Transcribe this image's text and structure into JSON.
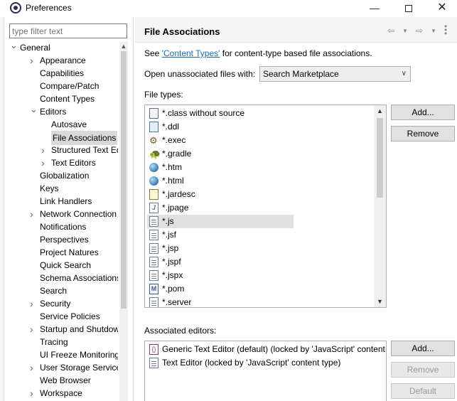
{
  "window": {
    "title": "Preferences",
    "minimize_glyph": "—",
    "close_glyph": "✕"
  },
  "filter": {
    "placeholder": "type filter text"
  },
  "tree": [
    {
      "label": "General",
      "level": 0,
      "arrow": "expanded"
    },
    {
      "label": "Appearance",
      "level": 1,
      "arrow": "collapsed"
    },
    {
      "label": "Capabilities",
      "level": 1,
      "arrow": "none"
    },
    {
      "label": "Compare/Patch",
      "level": 1,
      "arrow": "none"
    },
    {
      "label": "Content Types",
      "level": 1,
      "arrow": "none"
    },
    {
      "label": "Editors",
      "level": 1,
      "arrow": "expanded"
    },
    {
      "label": "Autosave",
      "level": 2,
      "arrow": "none"
    },
    {
      "label": "File Associations",
      "level": 2,
      "arrow": "none",
      "selected": true
    },
    {
      "label": "Structured Text Ed",
      "level": 2,
      "arrow": "collapsed"
    },
    {
      "label": "Text Editors",
      "level": 2,
      "arrow": "collapsed"
    },
    {
      "label": "Globalization",
      "level": 1,
      "arrow": "none"
    },
    {
      "label": "Keys",
      "level": 1,
      "arrow": "none"
    },
    {
      "label": "Link Handlers",
      "level": 1,
      "arrow": "none"
    },
    {
      "label": "Network Connection",
      "level": 1,
      "arrow": "collapsed"
    },
    {
      "label": "Notifications",
      "level": 1,
      "arrow": "none"
    },
    {
      "label": "Perspectives",
      "level": 1,
      "arrow": "none"
    },
    {
      "label": "Project Natures",
      "level": 1,
      "arrow": "none"
    },
    {
      "label": "Quick Search",
      "level": 1,
      "arrow": "none"
    },
    {
      "label": "Schema Associations",
      "level": 1,
      "arrow": "none"
    },
    {
      "label": "Search",
      "level": 1,
      "arrow": "none"
    },
    {
      "label": "Security",
      "level": 1,
      "arrow": "collapsed"
    },
    {
      "label": "Service Policies",
      "level": 1,
      "arrow": "none"
    },
    {
      "label": "Startup and Shutdow",
      "level": 1,
      "arrow": "collapsed"
    },
    {
      "label": "Tracing",
      "level": 1,
      "arrow": "none"
    },
    {
      "label": "UI Freeze Monitoring",
      "level": 1,
      "arrow": "none"
    },
    {
      "label": "User Storage Service",
      "level": 1,
      "arrow": "collapsed"
    },
    {
      "label": "Web Browser",
      "level": 1,
      "arrow": "none"
    },
    {
      "label": "Workspace",
      "level": 1,
      "arrow": "collapsed"
    }
  ],
  "page": {
    "title": "File Associations",
    "see_prefix": "See ",
    "see_link": "'Content Types'",
    "see_suffix": " for content-type based file associations.",
    "open_label": "Open unassociated files with:",
    "open_value": "Search Marketplace",
    "file_types_label": "File types:",
    "associated_label": "Associated editors:"
  },
  "file_types": [
    {
      "name": "*.class without source",
      "icon": "bin-icon"
    },
    {
      "name": "*.ddl",
      "icon": "db-icon"
    },
    {
      "name": "*.exec",
      "icon": "gear-icon"
    },
    {
      "name": "*.gradle",
      "icon": "turtle-icon"
    },
    {
      "name": "*.htm",
      "icon": "globe-icon"
    },
    {
      "name": "*.html",
      "icon": "globe-icon"
    },
    {
      "name": "*.jardesc",
      "icon": "jar-icon"
    },
    {
      "name": "*.jpage",
      "icon": "j-icon"
    },
    {
      "name": "*.js",
      "icon": "file-icon",
      "selected": true
    },
    {
      "name": "*.jsf",
      "icon": "file-icon"
    },
    {
      "name": "*.jsp",
      "icon": "file-icon"
    },
    {
      "name": "*.jspf",
      "icon": "file-icon"
    },
    {
      "name": "*.jspx",
      "icon": "file-icon"
    },
    {
      "name": "*.pom",
      "icon": "m-icon"
    },
    {
      "name": "*.server",
      "icon": "file-icon"
    }
  ],
  "associated_editors": [
    {
      "name": "Generic Text Editor (default) (locked by 'JavaScript' content type)",
      "icon": "brace-icon"
    },
    {
      "name": "Text Editor (locked by 'JavaScript' content type)",
      "icon": "file-icon"
    }
  ],
  "buttons": {
    "add": "Add...",
    "remove": "Remove",
    "default": "Default"
  }
}
